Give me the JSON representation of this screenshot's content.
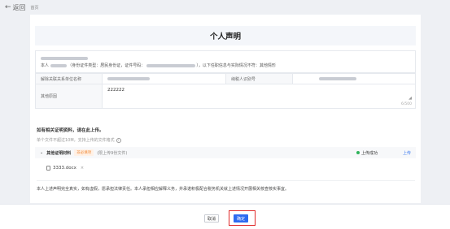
{
  "header": {
    "back_label": "返回",
    "breadcrumb": "首页"
  },
  "page": {
    "title": "个人声明"
  },
  "statement": {
    "person_prefix": "本人",
    "id_type_text": "（身份证件类型：居民身份证，证件号码：",
    "id_suffix": "），以下任职信息与实际情况不符：其他情形"
  },
  "info_row": {
    "employer_label": "解除关联关系单位名称",
    "taxpayer_label": "纳税人识别号"
  },
  "reason": {
    "label": "其他原因",
    "value": "222222",
    "counter": "6/500"
  },
  "proof": {
    "title": "如有相关证明资料，请在此上传。",
    "hint": "单个文件不超过10M，支持上传的文件格式"
  },
  "material": {
    "name": "其他证明材料",
    "tag": "非必填项",
    "note": "(限上传9份文件)",
    "status": "上传成功",
    "upload_label": "上传",
    "file_name": "3333.docx",
    "remove_glyph": "×"
  },
  "commitment": "本人上述声明完全真实，如有虚假，愿承担法律责任。本人承担相应解释义务，并承诺积极配合税务机关就上述情况开展相关核查核实事宜。",
  "footer": {
    "cancel_label": "取消",
    "confirm_label": "确定"
  },
  "colors": {
    "primary": "#2d6bf0",
    "success": "#2fb35b",
    "highlight": "#e02b2b",
    "tag": "#f08c3c"
  }
}
